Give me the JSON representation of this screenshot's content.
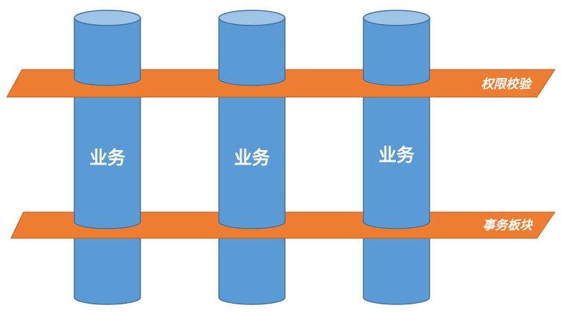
{
  "colors": {
    "cylinder_fill": "#5b9bd5",
    "cylinder_top": "#9dc3e6",
    "cylinder_stroke": "#41719c",
    "band_fill": "#ed7d31",
    "band_stroke": "#c55a11"
  },
  "columns": [
    {
      "label": "业务"
    },
    {
      "label": "业务"
    },
    {
      "label": "业务"
    }
  ],
  "bands": {
    "top": {
      "label": "权限校验"
    },
    "bottom": {
      "label": "事务板块"
    }
  }
}
